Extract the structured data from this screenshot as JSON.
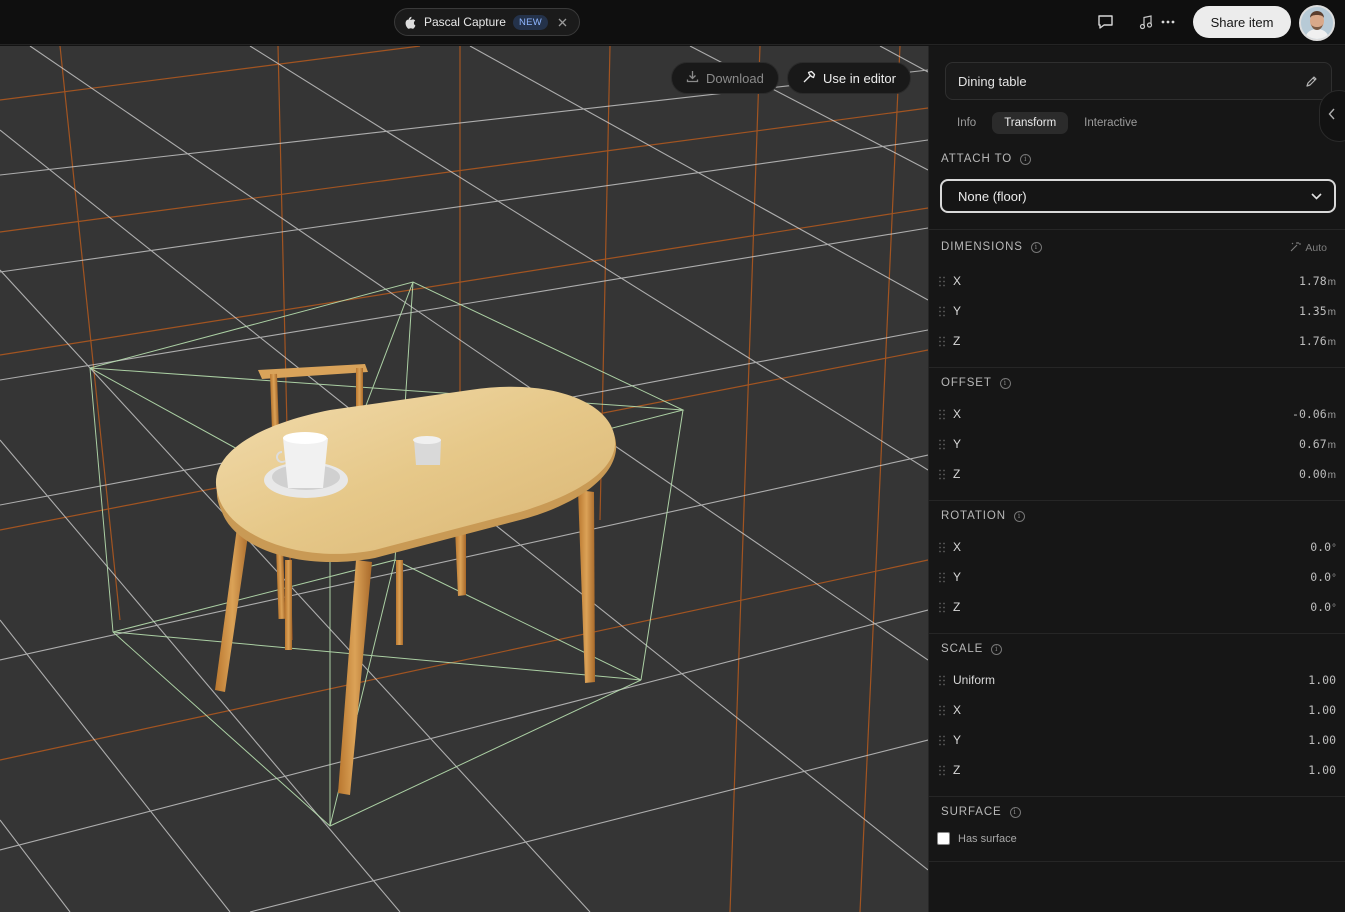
{
  "topbar": {
    "tab_title": "Pascal Capture",
    "tab_badge": "NEW",
    "share_label": "Share item",
    "icons": [
      "apple-icon",
      "close-icon",
      "chat-icon",
      "music-icon",
      "more-icon"
    ]
  },
  "viewport": {
    "download_label": "Download",
    "editor_label": "Use in editor"
  },
  "panel": {
    "item_name": "Dining table",
    "tabs": [
      {
        "label": "Info",
        "active": false
      },
      {
        "label": "Transform",
        "active": true
      },
      {
        "label": "Interactive",
        "active": false
      }
    ],
    "attach_to": {
      "label": "ATTACH TO",
      "selected": "None (floor)"
    },
    "dimensions": {
      "label": "DIMENSIONS",
      "auto_label": "Auto",
      "x": "1.78",
      "y": "1.35",
      "z": "1.76",
      "unit": "m"
    },
    "offset": {
      "label": "OFFSET",
      "x": "-0.06",
      "y": "0.67",
      "z": "0.00",
      "unit": "m"
    },
    "rotation": {
      "label": "ROTATION",
      "x": "0.0",
      "y": "0.0",
      "z": "0.0",
      "unit": "°"
    },
    "scale": {
      "label": "SCALE",
      "uniform_label": "Uniform",
      "uniform": "1.00",
      "x": "1.00",
      "y": "1.00",
      "z": "1.00"
    },
    "surface": {
      "label": "SURFACE",
      "has_surface_label": "Has surface",
      "has_surface": false
    },
    "axis_labels": {
      "x": "X",
      "y": "Y",
      "z": "Z"
    }
  },
  "colors": {
    "accent_orange": "#c8621c",
    "grid_white": "#d8d8d8",
    "bbox_green": "#b8e0b0",
    "table_wood": "#e9cf9b"
  }
}
